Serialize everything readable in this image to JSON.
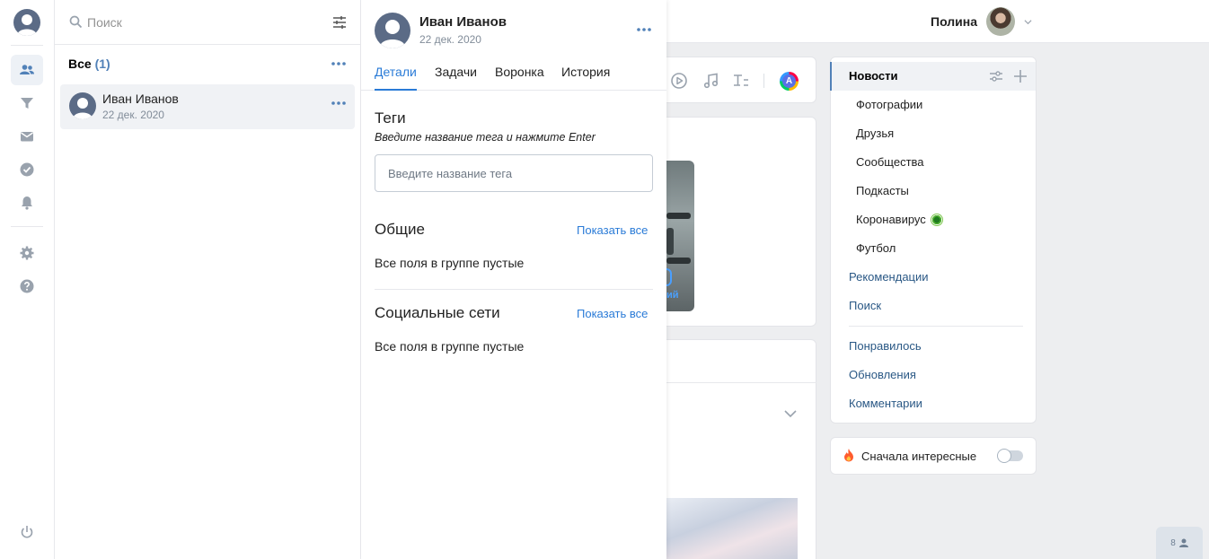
{
  "vk": {
    "user_name": "Полина",
    "news_menu": {
      "items": [
        {
          "label": "Новости"
        },
        {
          "label": "Фотографии"
        },
        {
          "label": "Друзья"
        },
        {
          "label": "Сообщества"
        },
        {
          "label": "Подкасты"
        },
        {
          "label": "Коронавирус"
        },
        {
          "label": "Футбол"
        },
        {
          "label": "Рекомендации"
        },
        {
          "label": "Поиск"
        },
        {
          "label": "Понравилось"
        },
        {
          "label": "Обновления"
        },
        {
          "label": "Комментарии"
        }
      ]
    },
    "interesting_first": "Сначала интересные",
    "toolbar_avatar_letter": "A",
    "video_caption": "ий",
    "chat_count": "8"
  },
  "crm": {
    "search": {
      "placeholder": "Поиск"
    },
    "group": {
      "title": "Все",
      "count": "(1)"
    },
    "contacts": [
      {
        "name": "Иван Иванов",
        "date": "22 дек. 2020"
      }
    ],
    "detail": {
      "name": "Иван Иванов",
      "date": "22 дек. 2020",
      "tabs": [
        {
          "label": "Детали",
          "active": true
        },
        {
          "label": "Задачи"
        },
        {
          "label": "Воронка"
        },
        {
          "label": "История"
        }
      ],
      "tags": {
        "title": "Теги",
        "hint": "Введите название тега и нажмите Enter",
        "placeholder": "Введите название тега"
      },
      "general": {
        "title": "Общие",
        "show_all": "Показать все",
        "empty": "Все поля в группе пустые"
      },
      "social": {
        "title": "Социальные сети",
        "show_all": "Показать все",
        "empty": "Все поля в группе пустые"
      }
    }
  },
  "colors": {
    "accent": "#2a7bd7",
    "rail_icon": "#99a2ad",
    "link": "#2a5885"
  }
}
